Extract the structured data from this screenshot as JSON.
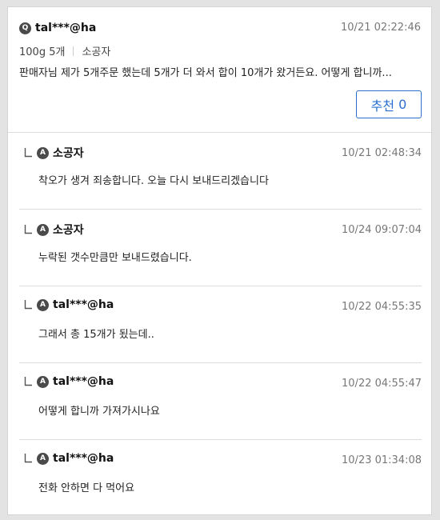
{
  "question": {
    "badge": "Q",
    "author": "tal***@ha",
    "time": "10/21 02:22:46",
    "option": "100g 5개",
    "seller": "소공자",
    "text": "판매자님 제가 5개주문 했는데 5개가 더 와서 합이 10개가 왔거든요. 어떻게 합니까...",
    "recommend_label": "추천",
    "recommend_count": "0"
  },
  "answers": [
    {
      "badge": "A",
      "author": "소공자",
      "time": "10/21 02:48:34",
      "text": "착오가 생겨 죄송합니다. 오늘 다시 보내드리겠습니다"
    },
    {
      "badge": "A",
      "author": "소공자",
      "time": "10/24 09:07:04",
      "text": "누락된 갯수만큼만 보내드렸습니다."
    },
    {
      "badge": "A",
      "author": "tal***@ha",
      "time": "10/22 04:55:35",
      "text": "그래서 총 15개가 됬는데.."
    },
    {
      "badge": "A",
      "author": "tal***@ha",
      "time": "10/22 04:55:47",
      "text": "어떻게 합니까 가져가시나요"
    },
    {
      "badge": "A",
      "author": "tal***@ha",
      "time": "10/23 01:34:08",
      "text": "전화 안하면 다 먹어요"
    }
  ],
  "colors": {
    "accent": "#2a6fd0",
    "badge": "#4a4a4a",
    "time": "#777777",
    "divider": "#dcdcdc"
  },
  "icons": {
    "question_badge": "q-badge-icon",
    "answer_badge": "a-badge-icon",
    "reply": "reply-arrow-icon"
  }
}
